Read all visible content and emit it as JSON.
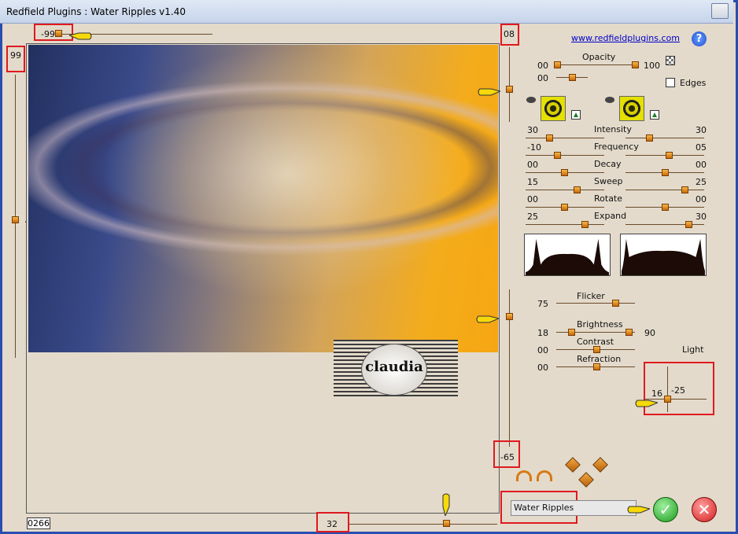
{
  "window": {
    "title": "Redfield Plugins : Water Ripples v1.40"
  },
  "top_slider": {
    "value": "-99"
  },
  "left_slider": {
    "value": "99"
  },
  "right_top_slider": {
    "value": "08"
  },
  "right_bottom_slider": {
    "value": "-65"
  },
  "bottom_slider": {
    "value": "32"
  },
  "counter": "0266",
  "link": "www.redfieldplugins.com",
  "help": "?",
  "opacity": {
    "label": "Opacity",
    "min": "00",
    "max": "100",
    "second": "00"
  },
  "edges": {
    "label": "Edges"
  },
  "params": [
    {
      "label": "Intensity",
      "left": "30",
      "right": "30"
    },
    {
      "label": "Frequency",
      "left": "-10",
      "right": "05"
    },
    {
      "label": "Decay",
      "left": "00",
      "right": "00"
    },
    {
      "label": "Sweep",
      "left": "15",
      "right": "25"
    },
    {
      "label": "Rotate",
      "left": "00",
      "right": "00"
    },
    {
      "label": "Expand",
      "left": "25",
      "right": "30"
    }
  ],
  "flicker": {
    "label": "Flicker",
    "value": "75"
  },
  "brightness": {
    "label": "Brightness",
    "left": "18",
    "right": "90"
  },
  "contrast": {
    "label": "Contrast",
    "value": "00"
  },
  "refraction": {
    "label": "Refraction",
    "value": "00"
  },
  "light": {
    "label": "Light",
    "x": "16",
    "y": "-25"
  },
  "preset": {
    "value": "Water Ripples"
  },
  "watermark": {
    "text": "claudia"
  },
  "colors": {
    "accent_red": "#e0191f",
    "knob": "#e38412",
    "title_bg": "#c6d4ea"
  }
}
